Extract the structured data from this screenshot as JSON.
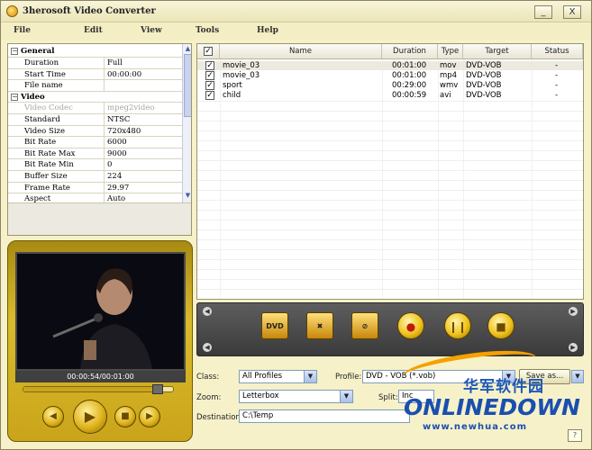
{
  "window": {
    "title": "3herosoft Video Converter",
    "minimize_label": "_",
    "close_label": "X"
  },
  "menu": {
    "items": [
      "File",
      "Edit",
      "View",
      "Tools",
      "Help"
    ]
  },
  "properties": {
    "general_header": "General",
    "video_header": "Video",
    "expander_symbol": "−",
    "rows": [
      {
        "key": "Duration",
        "value": "Full"
      },
      {
        "key": "Start Time",
        "value": "00:00:00"
      },
      {
        "key": "File name",
        "value": ""
      },
      {
        "key": "Video Codec",
        "value": "mpeg2video"
      },
      {
        "key": "Standard",
        "value": "NTSC"
      },
      {
        "key": "Video Size",
        "value": "720x480"
      },
      {
        "key": "Bit Rate",
        "value": "6000"
      },
      {
        "key": "Bit Rate Max",
        "value": "9000"
      },
      {
        "key": "Bit Rate Min",
        "value": "0"
      },
      {
        "key": "Buffer Size",
        "value": "224"
      },
      {
        "key": "Frame Rate",
        "value": "29.97"
      },
      {
        "key": "Aspect",
        "value": "Auto"
      }
    ]
  },
  "player": {
    "time_label": "00:00:54/00:01:00",
    "progress_fraction": 0.9,
    "buttons": {
      "prev": "◀",
      "play": "▶",
      "stop": "■",
      "next": "▶"
    }
  },
  "file_list": {
    "headers": {
      "check": "✓",
      "name": "Name",
      "duration": "Duration",
      "type": "Type",
      "target": "Target",
      "status": "Status"
    },
    "check_mark": "✓",
    "rows": [
      {
        "name": "movie_03",
        "duration": "00:01:00",
        "type": "mov",
        "target": "DVD-VOB",
        "status": "-"
      },
      {
        "name": "movie_03",
        "duration": "00:01:00",
        "type": "mp4",
        "target": "DVD-VOB",
        "status": "-"
      },
      {
        "name": "sport",
        "duration": "00:29:00",
        "type": "wmv",
        "target": "DVD-VOB",
        "status": "-"
      },
      {
        "name": "child",
        "duration": "00:00:59",
        "type": "avi",
        "target": "DVD-VOB",
        "status": "-"
      }
    ]
  },
  "toolbar": {
    "left_arrow": "◀",
    "right_arrow": "▶",
    "buttons": {
      "dvd": "DVD",
      "remove": "✖",
      "clear": "⊘",
      "record": "●",
      "pause": "❙❙",
      "stop": "■"
    }
  },
  "form": {
    "class_label": "Class:",
    "class_value": "All Profiles",
    "profile_label": "Profile:",
    "profile_value": "DVD - VOB  (*.vob)",
    "save_as_label": "Save as...",
    "zoom_label": "Zoom:",
    "zoom_value": "Letterbox",
    "split_label": "Split:",
    "split_value": "Inc",
    "destination_label": "Destination:",
    "destination_value": "C:\\Temp",
    "dropdown_arrow": "▼"
  },
  "watermark": {
    "cn_text": "华军软件园",
    "logo": "ONLINEDOWN",
    "url": "www.newhua.com"
  },
  "help_label": "?"
}
